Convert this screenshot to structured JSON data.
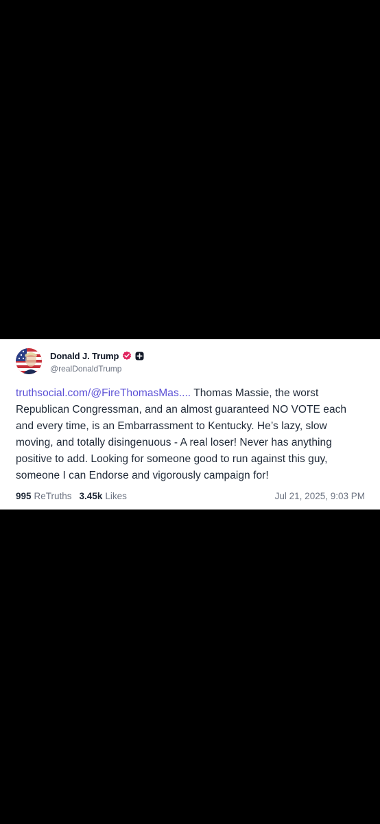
{
  "post": {
    "author": {
      "display_name": "Donald J. Trump",
      "handle": "@realDonaldTrump",
      "verified_icon": "verified-badge-icon",
      "plus_icon": "plus-square-icon",
      "avatar": "avatar-image"
    },
    "link_text": "truthsocial.com/@FireThomasMas....",
    "text": " Thomas Massie, the worst Republican Congressman, and an almost guaranteed NO VOTE each and every time, is an Embarrassment to Kentucky. He’s lazy, slow moving, and totally disingenuous - A real loser! Never has anything positive to add. Looking for someone good to run against this guy, someone I can Endorse and vigorously campaign for!",
    "retruths_count": "995",
    "retruths_label": "ReTruths",
    "likes_count": "3.45k",
    "likes_label": "Likes",
    "timestamp": "Jul 21, 2025, 9:03 PM"
  },
  "colors": {
    "background": "#000000",
    "card": "#ffffff",
    "link": "#5b50d6",
    "verified": "#e0245e",
    "muted": "#6b7280"
  }
}
